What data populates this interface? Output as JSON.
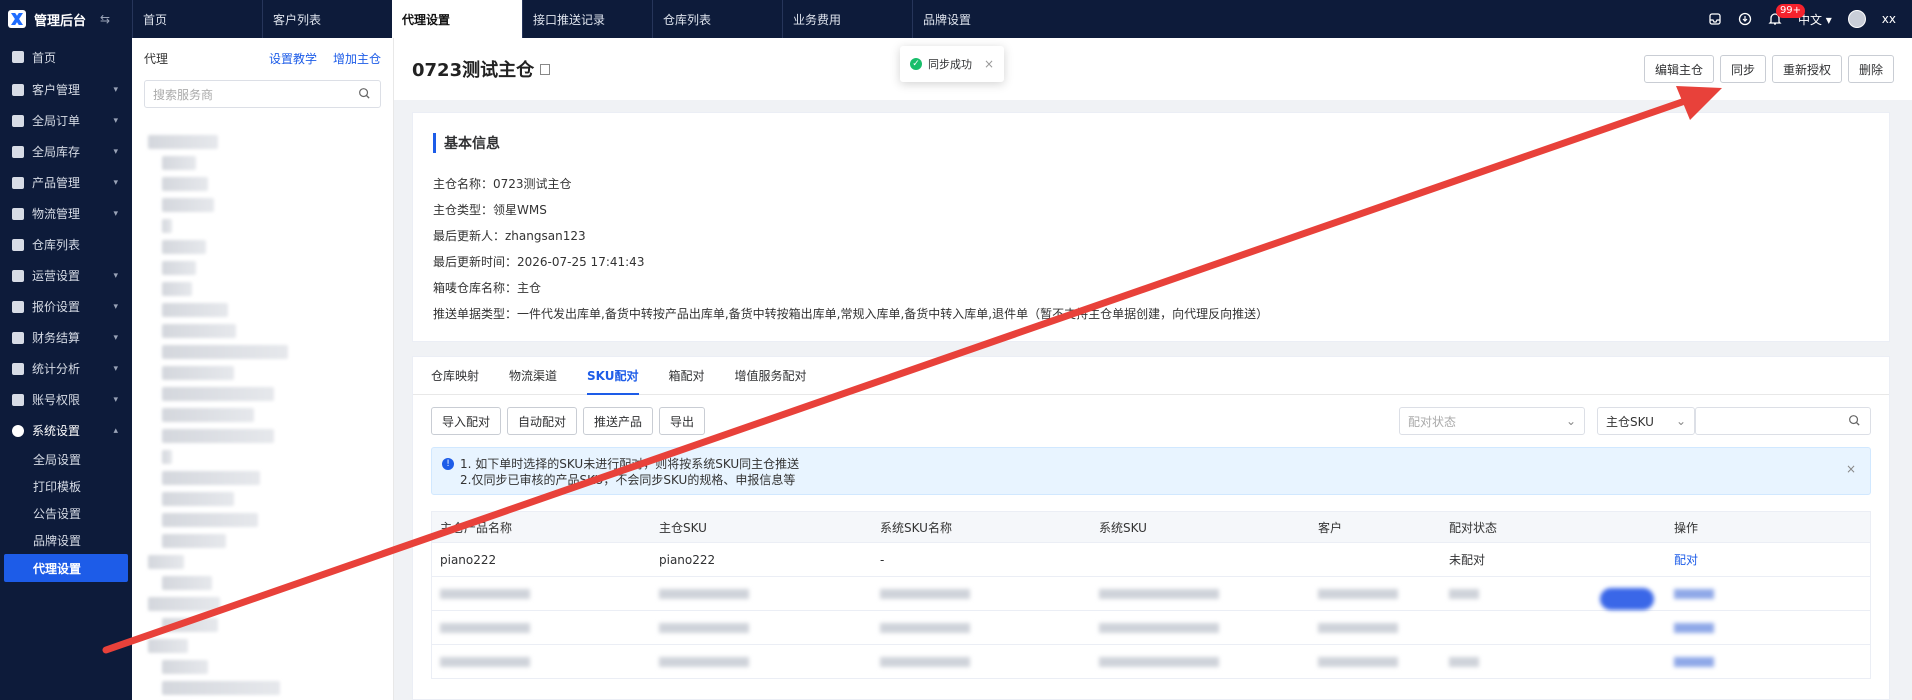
{
  "brand": {
    "title": "管理后台"
  },
  "tabs": [
    {
      "label": "首页"
    },
    {
      "label": "客户列表"
    },
    {
      "label": "代理设置"
    },
    {
      "label": "接口推送记录"
    },
    {
      "label": "仓库列表"
    },
    {
      "label": "业务费用"
    },
    {
      "label": "品牌设置"
    }
  ],
  "topright": {
    "badge": "99+",
    "language": "中文",
    "user": "xx"
  },
  "sidebar": {
    "items": [
      {
        "label": "首页"
      },
      {
        "label": "客户管理"
      },
      {
        "label": "全局订单"
      },
      {
        "label": "全局库存"
      },
      {
        "label": "产品管理"
      },
      {
        "label": "物流管理"
      },
      {
        "label": "仓库列表"
      },
      {
        "label": "运营设置"
      },
      {
        "label": "报价设置"
      },
      {
        "label": "财务结算"
      },
      {
        "label": "统计分析"
      },
      {
        "label": "账号权限"
      },
      {
        "label": "系统设置"
      }
    ],
    "subitems": [
      {
        "label": "全局设置"
      },
      {
        "label": "打印模板"
      },
      {
        "label": "公告设置"
      },
      {
        "label": "品牌设置"
      },
      {
        "label": "代理设置"
      }
    ]
  },
  "panel": {
    "title": "代理",
    "tutorial": "设置教学",
    "add": "增加主仓",
    "search_placeholder": "搜索服务商"
  },
  "page": {
    "title": "0723测试主仓",
    "buttons": {
      "edit": "编辑主仓",
      "sync": "同步",
      "reauth": "重新授权",
      "delete": "删除"
    }
  },
  "toast": {
    "text": "同步成功"
  },
  "basic": {
    "title": "基本信息",
    "lines": [
      "主仓名称：0723测试主仓",
      "主仓类型：领星WMS",
      "最后更新人：zhangsan123",
      "最后更新时间：2026-07-25 17:41:43",
      "箱唛仓库名称：主仓",
      "推送单据类型：一件代发出库单,备货中转按产品出库单,备货中转按箱出库单,常规入库单,备货中转入库单,退件单（暂不支持主仓单据创建，向代理反向推送）"
    ]
  },
  "subtabs": [
    {
      "label": "仓库映射"
    },
    {
      "label": "物流渠道"
    },
    {
      "label": "SKU配对"
    },
    {
      "label": "箱配对"
    },
    {
      "label": "增值服务配对"
    }
  ],
  "toolbar": {
    "import": "导入配对",
    "auto": "自动配对",
    "push": "推送产品",
    "export": "导出",
    "status_placeholder": "配对状态",
    "field_select": "主仓SKU"
  },
  "alert": {
    "line1": "1. 如下单时选择的SKU未进行配对，则将按系统SKU同主仓推送",
    "line2": "2.仅同步已审核的产品SKU，不会同步SKU的规格、申报信息等"
  },
  "table": {
    "headers": [
      "主仓产品名称",
      "主仓SKU",
      "系统SKU名称",
      "系统SKU",
      "客户",
      "配对状态",
      "操作"
    ],
    "rows": [
      {
        "name": "piano222",
        "sku": "piano222",
        "sys_name": "-",
        "sys_sku": "",
        "customer": "",
        "status": "未配对",
        "action": "配对"
      }
    ]
  },
  "colors": {
    "accent": "#1d5ce8",
    "topbar": "#0d1b3a",
    "arrow": "#e8413a",
    "success": "#19be6b"
  }
}
